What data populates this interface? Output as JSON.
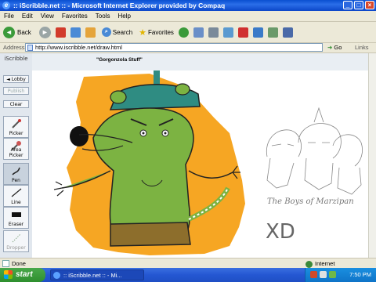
{
  "window": {
    "title": ":: iScribble.net :: - Microsoft Internet Explorer provided by Compaq"
  },
  "menu": [
    "File",
    "Edit",
    "View",
    "Favorites",
    "Tools",
    "Help"
  ],
  "toolbar": {
    "back_label": "Back",
    "search_label": "Search",
    "favorites_label": "Favorites"
  },
  "address": {
    "label": "Address",
    "url": "http://www.iscribble.net/draw.html",
    "go_label": "Go",
    "links_label": "Links"
  },
  "sidebar": {
    "app_name": "iScribble",
    "buttons": [
      "◄ Lobby",
      "Publish",
      "Clear"
    ],
    "tools": [
      "Picker",
      "Area Picker",
      "Pen",
      "Line",
      "Eraser",
      "Dropper"
    ]
  },
  "drawing": {
    "title": "\"Gorgonzola Stuff\"",
    "sketch_caption": "The Boys of Marzipan",
    "xd_text": "XD"
  },
  "status": {
    "text": "Done",
    "zone": "Internet"
  },
  "taskbar": {
    "start": "start",
    "task": ":: iScribble.net :: - Mi...",
    "clock": "7:50 PM"
  }
}
